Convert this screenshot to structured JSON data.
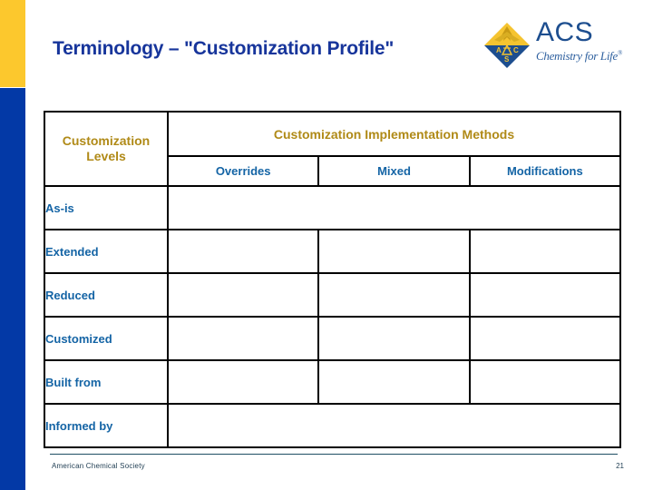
{
  "slide": {
    "title": "Terminology – \"Customization Profile\"",
    "accent_gold": "#fcc82d",
    "accent_blue": "#0339a6",
    "title_color": "#17359b",
    "header_gold": "#b08a17",
    "label_blue": "#1464a5"
  },
  "logo": {
    "name": "ACS",
    "tagline": "Chemistry for Life",
    "registered": "®",
    "mark_letters": [
      "A",
      "C",
      "S"
    ]
  },
  "table": {
    "levels_header": "Customization Levels",
    "methods_header": "Customization Implementation Methods",
    "method_columns": [
      "Overrides",
      "Mixed",
      "Modifications"
    ],
    "rows": [
      {
        "label": "As-is",
        "merged": true,
        "cells": [
          ""
        ]
      },
      {
        "label": "Extended",
        "merged": false,
        "cells": [
          "",
          "",
          ""
        ]
      },
      {
        "label": "Reduced",
        "merged": false,
        "cells": [
          "",
          "",
          ""
        ]
      },
      {
        "label": "Customized",
        "merged": false,
        "cells": [
          "",
          "",
          ""
        ]
      },
      {
        "label": "Built from",
        "merged": false,
        "cells": [
          "",
          "",
          ""
        ]
      },
      {
        "label": "Informed by",
        "merged": true,
        "cells": [
          ""
        ]
      }
    ]
  },
  "footer": {
    "organization": "American Chemical Society",
    "page_number": "21"
  }
}
